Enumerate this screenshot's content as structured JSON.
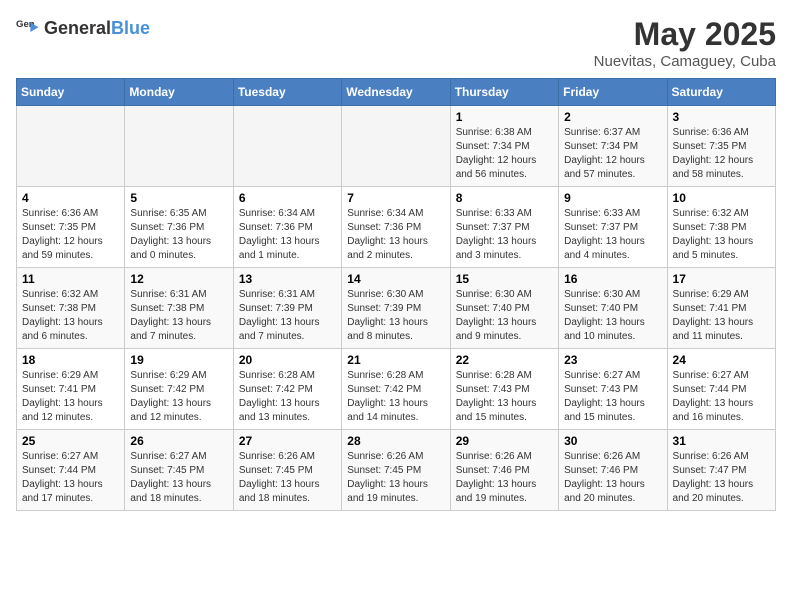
{
  "header": {
    "logo_general": "General",
    "logo_blue": "Blue",
    "month_year": "May 2025",
    "location": "Nuevitas, Camaguey, Cuba"
  },
  "days_of_week": [
    "Sunday",
    "Monday",
    "Tuesday",
    "Wednesday",
    "Thursday",
    "Friday",
    "Saturday"
  ],
  "weeks": [
    [
      {
        "day": "",
        "info": ""
      },
      {
        "day": "",
        "info": ""
      },
      {
        "day": "",
        "info": ""
      },
      {
        "day": "",
        "info": ""
      },
      {
        "day": "1",
        "info": "Sunrise: 6:38 AM\nSunset: 7:34 PM\nDaylight: 12 hours\nand 56 minutes."
      },
      {
        "day": "2",
        "info": "Sunrise: 6:37 AM\nSunset: 7:34 PM\nDaylight: 12 hours\nand 57 minutes."
      },
      {
        "day": "3",
        "info": "Sunrise: 6:36 AM\nSunset: 7:35 PM\nDaylight: 12 hours\nand 58 minutes."
      }
    ],
    [
      {
        "day": "4",
        "info": "Sunrise: 6:36 AM\nSunset: 7:35 PM\nDaylight: 12 hours\nand 59 minutes."
      },
      {
        "day": "5",
        "info": "Sunrise: 6:35 AM\nSunset: 7:36 PM\nDaylight: 13 hours\nand 0 minutes."
      },
      {
        "day": "6",
        "info": "Sunrise: 6:34 AM\nSunset: 7:36 PM\nDaylight: 13 hours\nand 1 minute."
      },
      {
        "day": "7",
        "info": "Sunrise: 6:34 AM\nSunset: 7:36 PM\nDaylight: 13 hours\nand 2 minutes."
      },
      {
        "day": "8",
        "info": "Sunrise: 6:33 AM\nSunset: 7:37 PM\nDaylight: 13 hours\nand 3 minutes."
      },
      {
        "day": "9",
        "info": "Sunrise: 6:33 AM\nSunset: 7:37 PM\nDaylight: 13 hours\nand 4 minutes."
      },
      {
        "day": "10",
        "info": "Sunrise: 6:32 AM\nSunset: 7:38 PM\nDaylight: 13 hours\nand 5 minutes."
      }
    ],
    [
      {
        "day": "11",
        "info": "Sunrise: 6:32 AM\nSunset: 7:38 PM\nDaylight: 13 hours\nand 6 minutes."
      },
      {
        "day": "12",
        "info": "Sunrise: 6:31 AM\nSunset: 7:38 PM\nDaylight: 13 hours\nand 7 minutes."
      },
      {
        "day": "13",
        "info": "Sunrise: 6:31 AM\nSunset: 7:39 PM\nDaylight: 13 hours\nand 7 minutes."
      },
      {
        "day": "14",
        "info": "Sunrise: 6:30 AM\nSunset: 7:39 PM\nDaylight: 13 hours\nand 8 minutes."
      },
      {
        "day": "15",
        "info": "Sunrise: 6:30 AM\nSunset: 7:40 PM\nDaylight: 13 hours\nand 9 minutes."
      },
      {
        "day": "16",
        "info": "Sunrise: 6:30 AM\nSunset: 7:40 PM\nDaylight: 13 hours\nand 10 minutes."
      },
      {
        "day": "17",
        "info": "Sunrise: 6:29 AM\nSunset: 7:41 PM\nDaylight: 13 hours\nand 11 minutes."
      }
    ],
    [
      {
        "day": "18",
        "info": "Sunrise: 6:29 AM\nSunset: 7:41 PM\nDaylight: 13 hours\nand 12 minutes."
      },
      {
        "day": "19",
        "info": "Sunrise: 6:29 AM\nSunset: 7:42 PM\nDaylight: 13 hours\nand 12 minutes."
      },
      {
        "day": "20",
        "info": "Sunrise: 6:28 AM\nSunset: 7:42 PM\nDaylight: 13 hours\nand 13 minutes."
      },
      {
        "day": "21",
        "info": "Sunrise: 6:28 AM\nSunset: 7:42 PM\nDaylight: 13 hours\nand 14 minutes."
      },
      {
        "day": "22",
        "info": "Sunrise: 6:28 AM\nSunset: 7:43 PM\nDaylight: 13 hours\nand 15 minutes."
      },
      {
        "day": "23",
        "info": "Sunrise: 6:27 AM\nSunset: 7:43 PM\nDaylight: 13 hours\nand 15 minutes."
      },
      {
        "day": "24",
        "info": "Sunrise: 6:27 AM\nSunset: 7:44 PM\nDaylight: 13 hours\nand 16 minutes."
      }
    ],
    [
      {
        "day": "25",
        "info": "Sunrise: 6:27 AM\nSunset: 7:44 PM\nDaylight: 13 hours\nand 17 minutes."
      },
      {
        "day": "26",
        "info": "Sunrise: 6:27 AM\nSunset: 7:45 PM\nDaylight: 13 hours\nand 18 minutes."
      },
      {
        "day": "27",
        "info": "Sunrise: 6:26 AM\nSunset: 7:45 PM\nDaylight: 13 hours\nand 18 minutes."
      },
      {
        "day": "28",
        "info": "Sunrise: 6:26 AM\nSunset: 7:45 PM\nDaylight: 13 hours\nand 19 minutes."
      },
      {
        "day": "29",
        "info": "Sunrise: 6:26 AM\nSunset: 7:46 PM\nDaylight: 13 hours\nand 19 minutes."
      },
      {
        "day": "30",
        "info": "Sunrise: 6:26 AM\nSunset: 7:46 PM\nDaylight: 13 hours\nand 20 minutes."
      },
      {
        "day": "31",
        "info": "Sunrise: 6:26 AM\nSunset: 7:47 PM\nDaylight: 13 hours\nand 20 minutes."
      }
    ]
  ]
}
